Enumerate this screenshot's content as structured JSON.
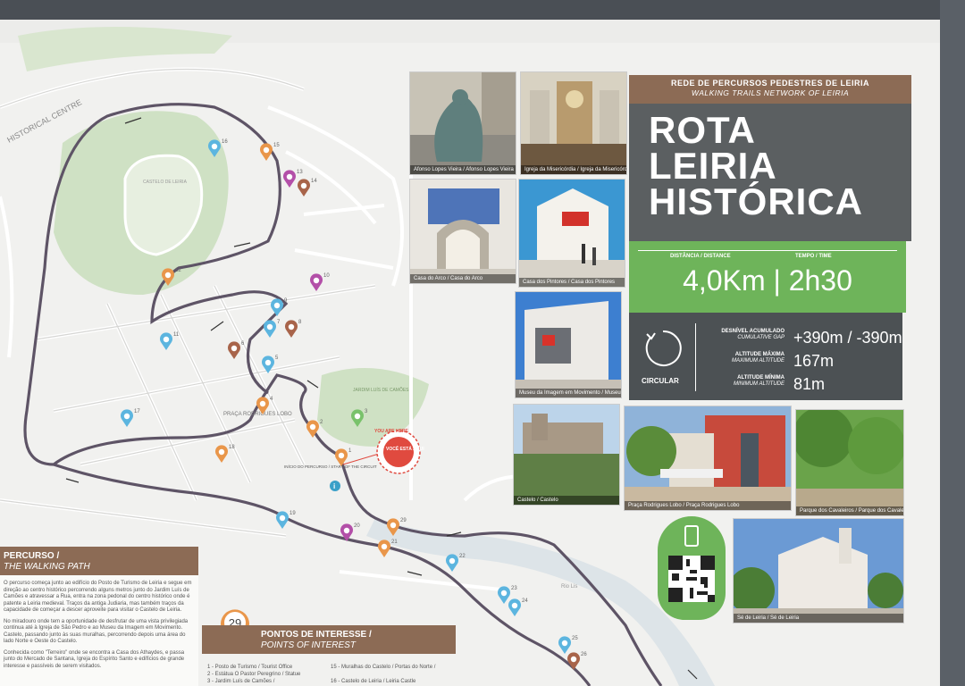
{
  "photos": [
    {
      "caption": "Afonso Lopes Vieira / Afonso Lopes Vieira",
      "color": "#6f8a8f"
    },
    {
      "caption": "Igreja da Misericórdia / Igreja da Misericórdia",
      "color": "#b9ac98"
    },
    {
      "caption": "Casa do Arco / Casa do Arco",
      "color": "#8a98b5"
    },
    {
      "caption": "Casa dos Pintores / Casa dos Pintores",
      "color": "#3b97d2"
    },
    {
      "caption": "Museu da Imagem em Movimento / Museu da Imagem em Movimento",
      "color": "#3d7fd0"
    },
    {
      "caption": "Castelo / Castelo",
      "color": "#5f7f46"
    },
    {
      "caption": "Praça Rodrigues Lobo / Praça Rodrigues Lobo",
      "color": "#7d8f9e"
    },
    {
      "caption": "Parque dos Cavaleiros / Parque dos Cavaleiros",
      "color": "#5e8e3f"
    },
    {
      "caption": "Sé de Leiria / Sé de Leiria",
      "color": "#6b9ad4"
    }
  ],
  "title_panel": {
    "network_pt": "REDE DE PERCURSOS PEDESTRES DE LEIRIA",
    "network_en": "WALKING TRAILS NETWORK OF LEIRIA",
    "title_line1": "ROTA",
    "title_line2": "LEIRIA",
    "title_line3": "HISTÓRICA"
  },
  "stats": {
    "distance_label": "DISTÂNCIA / DISTANCE",
    "time_label": "TEMPO / TIME",
    "distance_time": "4,0Km | 2h30",
    "circular_label": "CIRCULAR",
    "rows": [
      {
        "label": "DESNÍVEL ACUMULADO",
        "label_en": "CUMULATIVE GAP",
        "value": "+390m / -390m"
      },
      {
        "label": "ALTITUDE MÁXIMA",
        "label_en": "MAXIMUM ALTITUDE",
        "value": "167m"
      },
      {
        "label": "ALTITUDE MÍNIMA",
        "label_en": "MINIMUM ALTITUDE",
        "value": "81m"
      }
    ]
  },
  "map": {
    "historical_centre": "HISTORICAL CENTRE",
    "castle_label": "CASTELO DE LEIRIA",
    "square_label": "PRAÇA RODRIGUES LOBO",
    "park_label": "JARDIM LUÍS DE CAMÕES",
    "start_label": "INÍCIO DO PERCURSO / START OF THE CIRCUIT",
    "you_are_here": "YOU ARE HERE",
    "voce_esta_aqui": "VOCÊ ESTÁ AQUI",
    "river_label": "Rio Lis",
    "markers": [
      "1",
      "2",
      "3",
      "4",
      "5",
      "6",
      "7",
      "8",
      "9",
      "10",
      "11",
      "12",
      "13",
      "14",
      "15",
      "16",
      "17",
      "18",
      "19",
      "20",
      "21",
      "22",
      "23",
      "24",
      "25",
      "26",
      "29"
    ]
  },
  "legend": {
    "title": "PERCURSO /",
    "subtitle": "THE WALKING PATH",
    "paragraphs": [
      "O percurso começa junto ao edifício do Posto de Turismo de Leiria e segue em direção ao centro histórico percorrendo alguns metros junto do Jardim Luís de Camões e atravessar a Rua, entra na zona pedonal do centro histórico onde é patente a Leiria medieval. Traços da antiga Judiaria, mas também traços da capacidade de começar a descer aproveite para visitar o Castelo de Leiria.",
      "No miradouro onde tem a oportunidade de desfrutar de uma vista privilegiada continua até à Igreja de São Pedro e ao Museu da Imagem em Movimento. Castelo, passando junto às suas muralhas, percorrendo depois uma área do lado Norte e Oeste do Castelo.",
      "Conhecida como \"Terreiro\" onde se encontra a Casa dos Athaydes, e passa junto do Mercado de Santana, Igreja do Espírito Santo e edifícios de grande interesse e passíveis de serem visitados."
    ]
  },
  "poi": {
    "number": "29",
    "title": "PONTOS DE INTERESSE /",
    "subtitle": "POINTS OF INTEREST",
    "items_left": [
      "1 - Posto de Turismo / Tourist Office",
      "2 - Estátua O Pastor Peregrino / Statue",
      "3 - Jardim Luís de Camões /"
    ],
    "items_right": [
      "15 - Muralhas do Castelo / Portas do Norte /",
      "16 - Castelo de Leiria / Leiria Castle"
    ]
  }
}
